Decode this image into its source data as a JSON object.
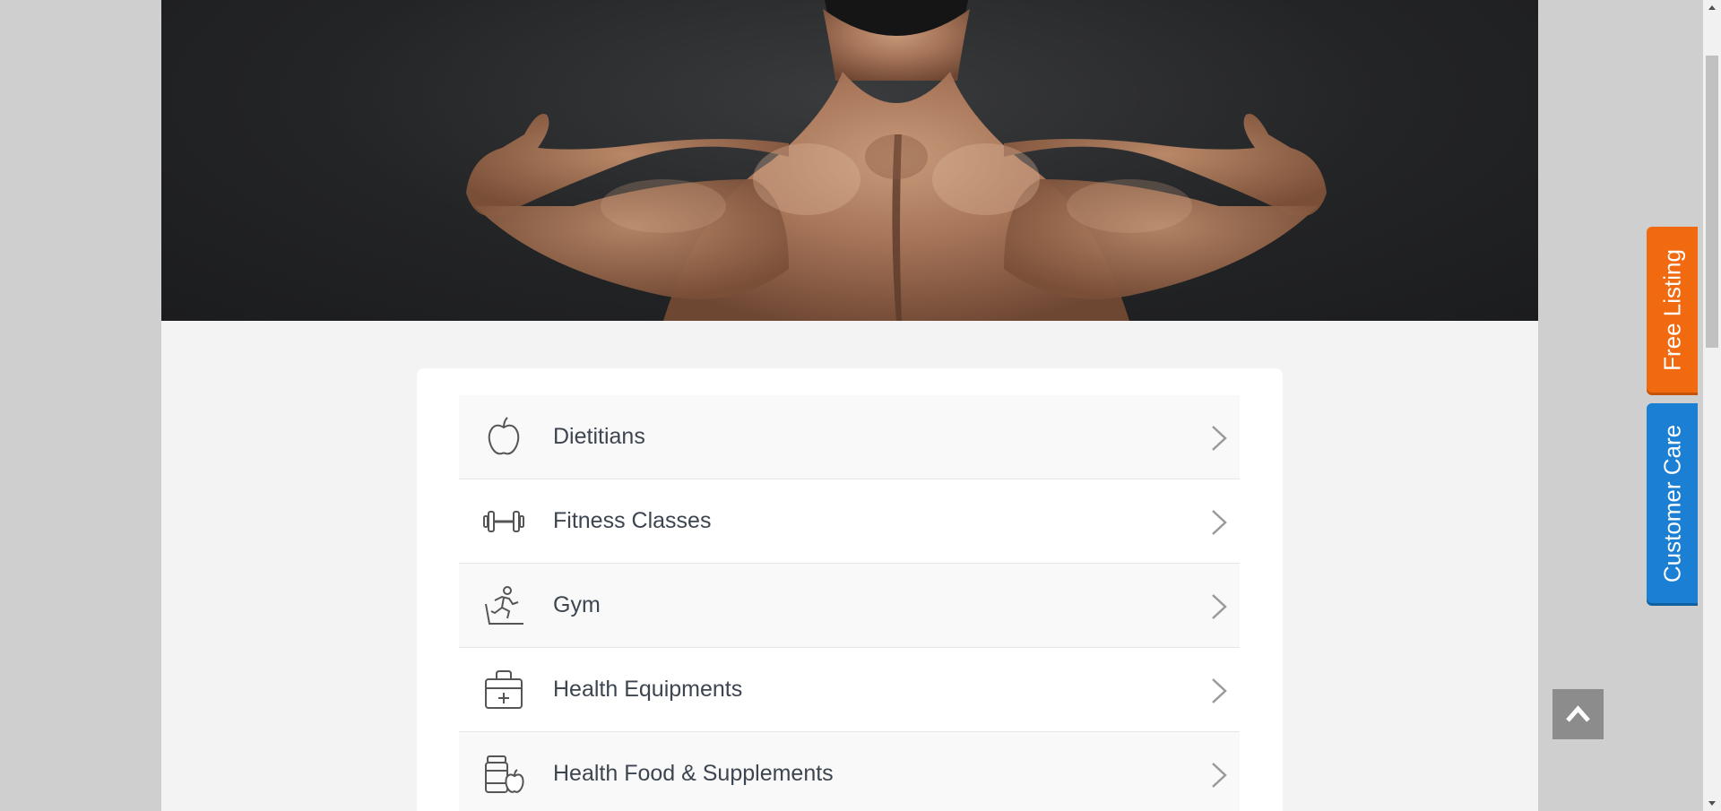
{
  "categories": [
    {
      "label": "Dietitians",
      "icon": "apple-icon"
    },
    {
      "label": "Fitness Classes",
      "icon": "dumbbell-icon"
    },
    {
      "label": "Gym",
      "icon": "treadmill-runner-icon"
    },
    {
      "label": "Health Equipments",
      "icon": "medical-kit-icon"
    },
    {
      "label": "Health Food & Supplements",
      "icon": "supplement-jar-icon"
    }
  ],
  "side_tabs": {
    "free_listing": "Free Listing",
    "customer_care": "Customer Care"
  },
  "colors": {
    "free_listing": "#f26a10",
    "customer_care": "#1b7fd4",
    "label_text": "#3c4550"
  }
}
